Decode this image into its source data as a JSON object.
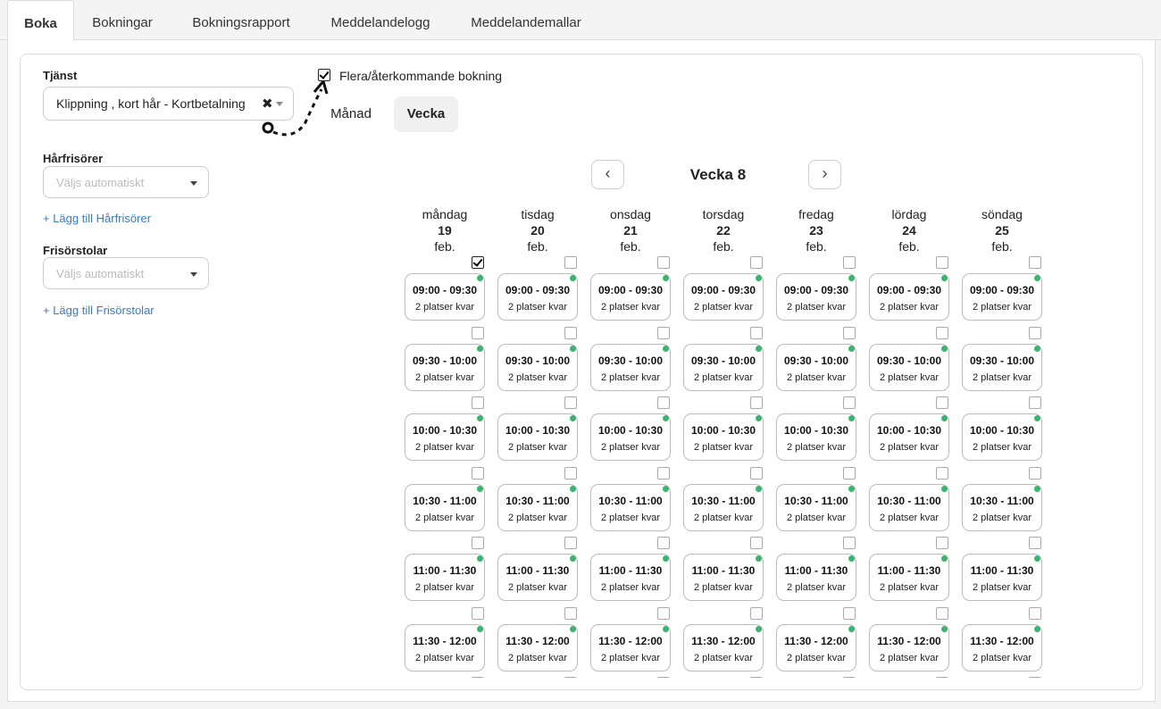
{
  "tabs": [
    "Boka",
    "Bokningar",
    "Bokningsrapport",
    "Meddelandelogg",
    "Meddelandemallar"
  ],
  "active_tab": "Boka",
  "service": {
    "label": "Tjänst",
    "value": "Klippning , kort hår - Kortbetalning",
    "clear_icon": "close-icon"
  },
  "multi_booking": {
    "label": "Flera/återkommande bokning",
    "checked": true
  },
  "view_toggle": {
    "month_label": "Månad",
    "week_label": "Vecka",
    "active": "Vecka"
  },
  "stylists": {
    "label": "Hårfrisörer",
    "placeholder": "Väljs automatiskt",
    "add_link": "+ Lägg till Hårfrisörer"
  },
  "chairs": {
    "label": "Frisörstolar",
    "placeholder": "Väljs automatiskt",
    "add_link": "+ Lägg till Frisörstolar"
  },
  "calendar": {
    "prev_icon": "chevron-left-icon",
    "next_icon": "chevron-right-icon",
    "week_title": "Vecka 8",
    "days": [
      {
        "name": "måndag",
        "date": "19",
        "month": "feb.",
        "checked": true
      },
      {
        "name": "tisdag",
        "date": "20",
        "month": "feb.",
        "checked": false
      },
      {
        "name": "onsdag",
        "date": "21",
        "month": "feb.",
        "checked": false
      },
      {
        "name": "torsdag",
        "date": "22",
        "month": "feb.",
        "checked": false
      },
      {
        "name": "fredag",
        "date": "23",
        "month": "feb.",
        "checked": false
      },
      {
        "name": "lördag",
        "date": "24",
        "month": "feb.",
        "checked": false
      },
      {
        "name": "söndag",
        "date": "25",
        "month": "feb.",
        "checked": false
      }
    ],
    "slots": [
      {
        "time": "09:00 - 09:30",
        "availability": "2 platser kvar"
      },
      {
        "time": "09:30 - 10:00",
        "availability": "2 platser kvar"
      },
      {
        "time": "10:00 - 10:30",
        "availability": "2 platser kvar"
      },
      {
        "time": "10:30 - 11:00",
        "availability": "2 platser kvar"
      },
      {
        "time": "11:00 - 11:30",
        "availability": "2 platser kvar"
      },
      {
        "time": "11:30 - 12:00",
        "availability": "2 platser kvar"
      }
    ],
    "status_color": "#3cb371"
  }
}
